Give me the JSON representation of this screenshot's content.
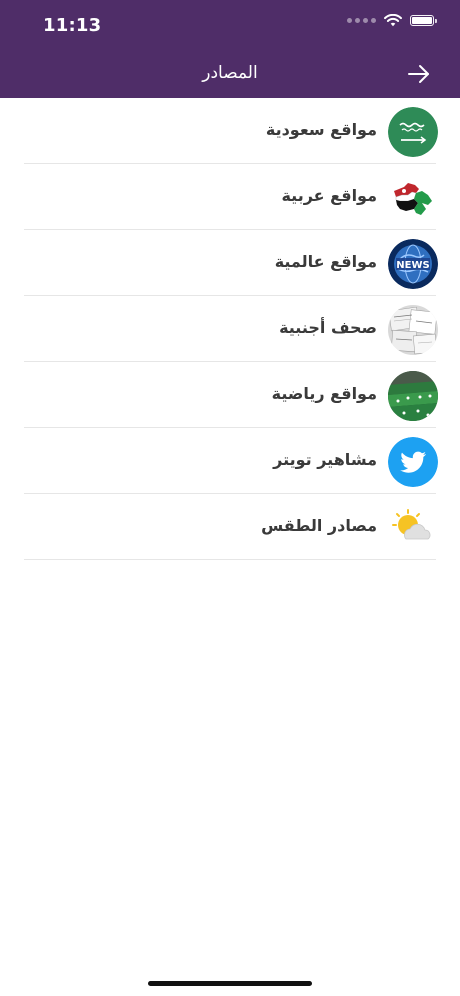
{
  "status_bar": {
    "time": "11:13",
    "icons": [
      "cellular-signal-icon",
      "wifi-icon",
      "battery-icon"
    ]
  },
  "nav": {
    "title": "المصادر",
    "back_icon": "arrow-right-icon"
  },
  "sources": [
    {
      "label": "مواقع سعودية",
      "icon": "saudi-flag-icon"
    },
    {
      "label": "مواقع عربية",
      "icon": "arab-map-icon"
    },
    {
      "label": "مواقع عالمية",
      "icon": "world-news-globe-icon"
    },
    {
      "label": "صحف أجنبية",
      "icon": "foreign-newspapers-icon"
    },
    {
      "label": "مواقع رياضية",
      "icon": "stadium-crowd-icon"
    },
    {
      "label": "مشاهير تويتر",
      "icon": "twitter-bird-icon"
    },
    {
      "label": "مصادر الطقس",
      "icon": "weather-sun-cloud-icon"
    }
  ],
  "colors": {
    "header_bg": "#4f2d68",
    "label_text": "#3a3a3a",
    "divider": "#e6e6e6",
    "saudi_green": "#2e8b57",
    "twitter_blue": "#1da1f2"
  }
}
